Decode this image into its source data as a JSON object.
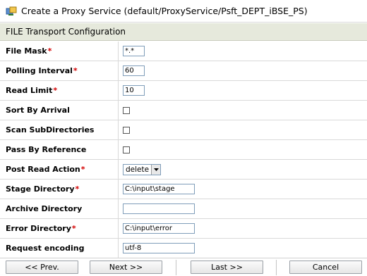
{
  "window": {
    "title": "Create a Proxy Service (default/ProxyService/Psft_DEPT_iBSE_PS)",
    "icon": "proxy-service-icon"
  },
  "section": {
    "title": "FILE Transport Configuration"
  },
  "form": {
    "required_marker": "*",
    "fields": [
      {
        "label": "File Mask",
        "required": true,
        "type": "text",
        "value": "*.*"
      },
      {
        "label": "Polling Interval",
        "required": true,
        "type": "text",
        "value": "60"
      },
      {
        "label": "Read Limit",
        "required": true,
        "type": "text",
        "value": "10"
      },
      {
        "label": "Sort By Arrival",
        "required": false,
        "type": "checkbox",
        "checked": false
      },
      {
        "label": "Scan SubDirectories",
        "required": false,
        "type": "checkbox",
        "checked": false
      },
      {
        "label": "Pass By Reference",
        "required": false,
        "type": "checkbox",
        "checked": false
      },
      {
        "label": "Post Read Action",
        "required": true,
        "type": "select",
        "value": "delete"
      },
      {
        "label": "Stage Directory",
        "required": true,
        "type": "text",
        "value": "C:\\input\\stage"
      },
      {
        "label": "Archive Directory",
        "required": false,
        "type": "text",
        "value": ""
      },
      {
        "label": "Error Directory",
        "required": true,
        "type": "text",
        "value": "C:\\input\\error"
      },
      {
        "label": "Request encoding",
        "required": false,
        "type": "text",
        "value": "utf-8"
      }
    ]
  },
  "buttons": {
    "prev": "<< Prev.",
    "next": "Next >>",
    "last": "Last >>",
    "cancel": "Cancel"
  },
  "colors": {
    "section_bg": "#e6e9dc",
    "required": "#d40000",
    "input_border": "#7f9db9"
  }
}
